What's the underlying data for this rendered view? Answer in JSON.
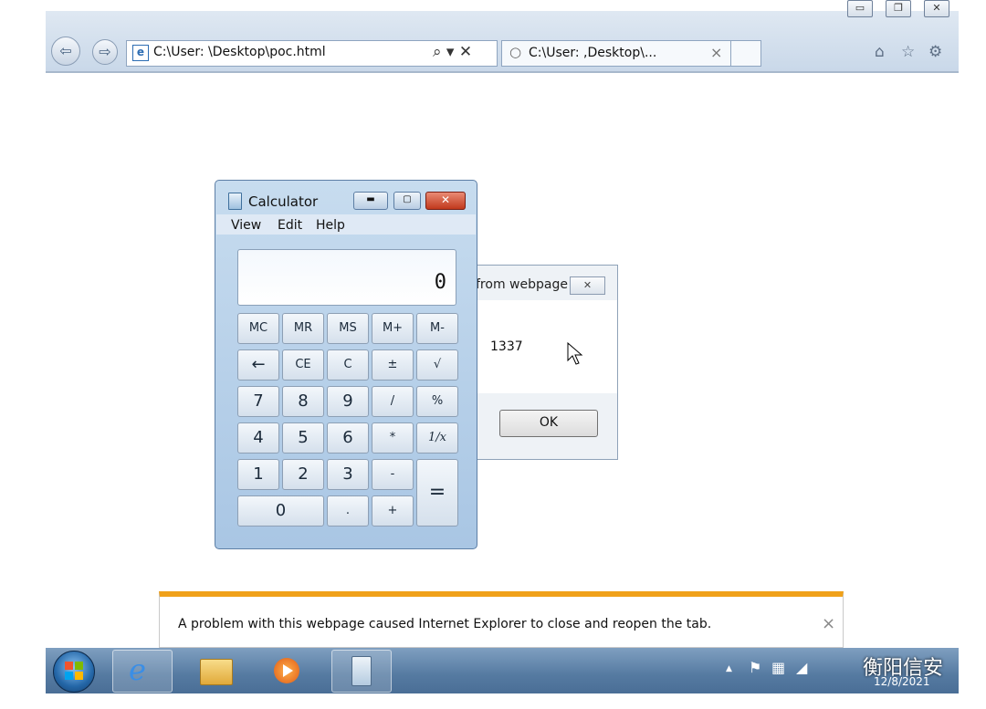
{
  "ie": {
    "address": "C:\\User:          \\Desktop\\poc.html",
    "address_controls": "⌕ ▾ ✕",
    "tab_title": "C:\\User:          ,Desktop\\...",
    "tab_close": "×",
    "toolbar_icons": [
      "home-icon",
      "favorites-star-icon",
      "tools-gear-icon"
    ],
    "window_buttons": [
      "minimize-icon",
      "restore-icon",
      "close-icon"
    ]
  },
  "calculator": {
    "title": "Calculator",
    "menu": [
      "View",
      "Edit",
      "Help"
    ],
    "display": "0",
    "memory_row": [
      "MC",
      "MR",
      "MS",
      "M+",
      "M-"
    ],
    "row2": [
      "←",
      "CE",
      "C",
      "±",
      "√"
    ],
    "row3": [
      "7",
      "8",
      "9",
      "/",
      "%"
    ],
    "row4": [
      "4",
      "5",
      "6",
      "*",
      "1/x"
    ],
    "row5": [
      "1",
      "2",
      "3",
      "-"
    ],
    "row6": [
      "0",
      ".",
      "+"
    ],
    "equals": "="
  },
  "dialog": {
    "title": "from webpage",
    "message": "1337",
    "ok_label": "OK"
  },
  "notification": {
    "text": "A problem with this webpage caused Internet Explorer to close and reopen the tab.",
    "close": "×"
  },
  "taskbar": {
    "apps": [
      "start-orb-icon",
      "internet-explorer-icon",
      "file-explorer-icon",
      "media-player-icon",
      "calculator-icon"
    ],
    "tray_arrow": "▲",
    "date": "12/8/2021"
  },
  "watermark": "衡阳信安"
}
